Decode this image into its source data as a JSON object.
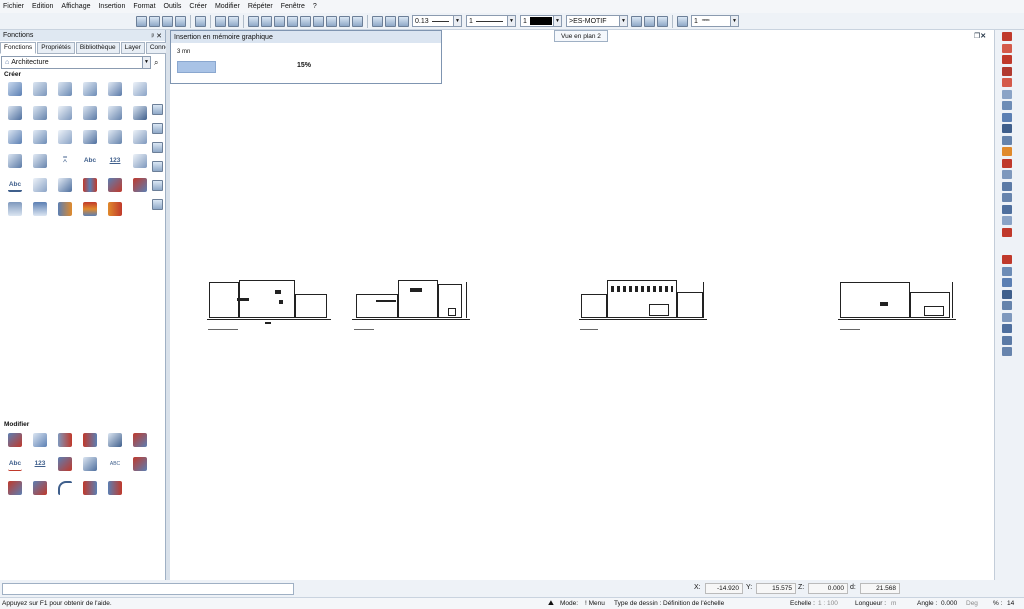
{
  "menu": [
    "Fichier",
    "Edition",
    "Affichage",
    "Insertion",
    "Format",
    "Outils",
    "Créer",
    "Modifier",
    "Répéter",
    "Fenêtre",
    "?"
  ],
  "toolbar": {
    "line_thickness": "0.13",
    "line_type": "1",
    "pen_color": "1",
    "hatch_style": ">ES-MOTIF",
    "layer_value": "1"
  },
  "tooltip": "Vue en plan 2",
  "progress": {
    "title": "Insertion en mémoire graphique",
    "time": "3 mn",
    "percent_label": "15%",
    "fraction": 0.15
  },
  "left_panel": {
    "title": "Fonctions",
    "pin": "ᵖ ✕",
    "tabs": [
      "Fonctions",
      "Propriétés",
      "Bibliothèque",
      "Layer",
      "Connect"
    ],
    "category": "Architecture",
    "section_create": "Créer",
    "section_modify": "Modifier",
    "create_text_icons": {
      "abc": "Abc",
      "num": "123",
      "abc2": "Abc"
    },
    "modify_text_icons": {
      "abc": "Abc",
      "num": "123",
      "abc2": "ABC"
    }
  },
  "status": {
    "coord_x_label": "X:",
    "coord_x": "-14.920",
    "coord_y_label": "Y:",
    "coord_y": "15.575",
    "coord_z_label": "Z:",
    "coord_z": "0.000",
    "coord_d_label": "d:",
    "coord_d": "21.568",
    "help": "Appuyez sur F1 pour obtenir de l'aide.",
    "mode_label": "Mode:",
    "mode_value": "! Menu",
    "drawing_type_label": "Type de dessin :",
    "drawing_type_value": "Définition de l'échelle",
    "scale_label": "Echelle :",
    "scale_value": "1 : 100",
    "length_label": "Longueur :",
    "length_unit": "m",
    "angle_label": "Angle :",
    "angle_value": "0.000",
    "angle_unit": "Deg",
    "percent_label": "% :",
    "percent_value": "14"
  },
  "colors": {
    "accent": "#a9c3e6",
    "icon_blue": "#5b7fb3",
    "icon_red": "#c0392b",
    "icon_orange": "#e08a2c"
  }
}
